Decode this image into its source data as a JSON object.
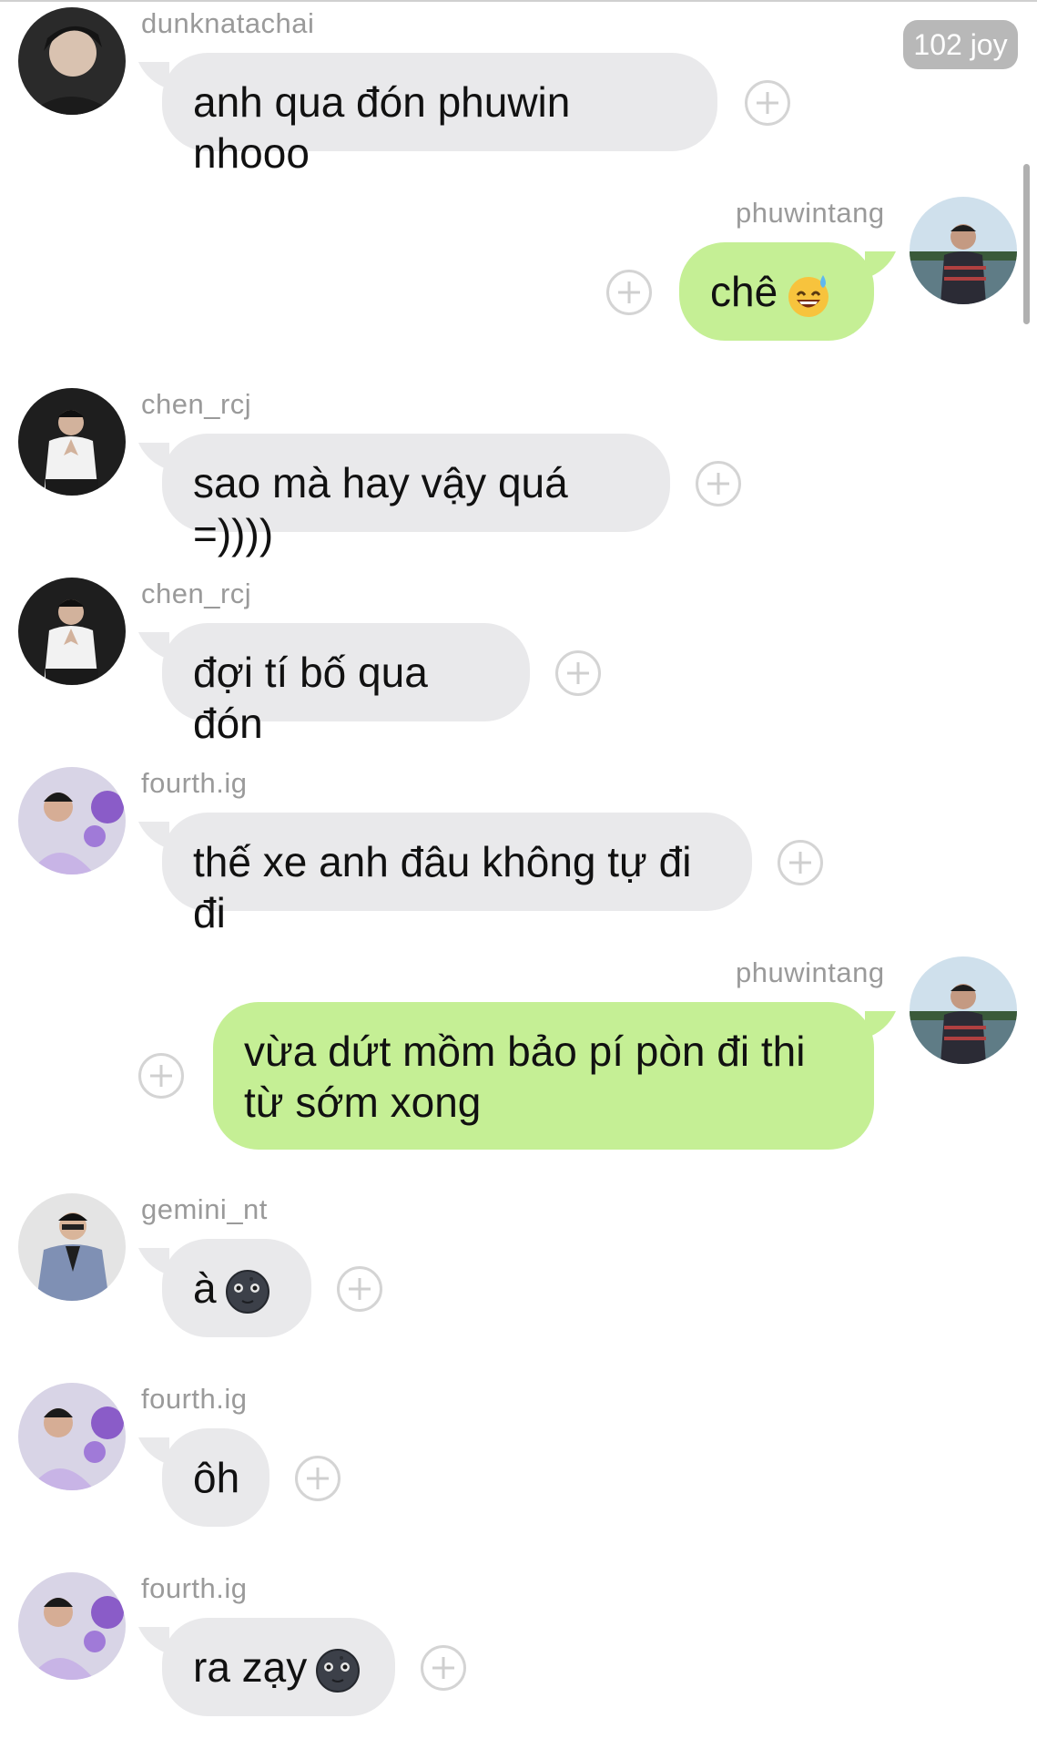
{
  "badge": {
    "label": "102 joy"
  },
  "colors": {
    "incoming_bubble": "#e9e9eb",
    "outgoing_bubble": "#c5ef95",
    "username": "#9a9a9a"
  },
  "messages": [
    {
      "user": "dunknatachai",
      "text": "anh qua đón phuwin nhooo",
      "side": "in",
      "avatar": "avatar-dunk"
    },
    {
      "user": "phuwintang",
      "text": "chê",
      "emoji": "sweat-smile-emoji",
      "side": "out",
      "avatar": "avatar-phuwin"
    },
    {
      "user": "chen_rcj",
      "text": "sao mà hay vậy quá =))))",
      "side": "in",
      "avatar": "avatar-chen"
    },
    {
      "user": "chen_rcj",
      "text": "đợi tí bố qua đón",
      "side": "in",
      "avatar": "avatar-chen"
    },
    {
      "user": "fourth.ig",
      "text": "thế xe anh đâu không tự đi đi",
      "side": "in",
      "avatar": "avatar-fourth"
    },
    {
      "user": "phuwintang",
      "text": "vừa dứt mồm bảo pí pòn đi thi từ sớm xong",
      "side": "out",
      "avatar": "avatar-phuwin"
    },
    {
      "user": "gemini_nt",
      "text": "à",
      "emoji": "new-moon-face-emoji",
      "side": "in",
      "avatar": "avatar-gemini"
    },
    {
      "user": "fourth.ig",
      "text": "ôh",
      "side": "in",
      "avatar": "avatar-fourth"
    },
    {
      "user": "fourth.ig",
      "text": "ra zạy",
      "emoji": "new-moon-face-emoji",
      "side": "in",
      "avatar": "avatar-fourth"
    }
  ]
}
